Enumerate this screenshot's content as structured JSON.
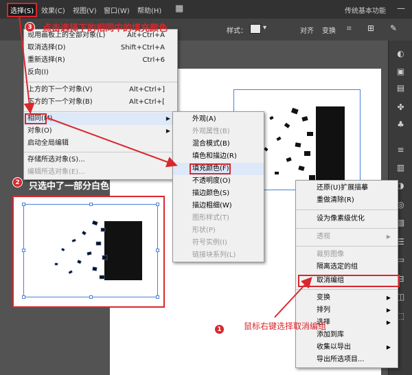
{
  "menubar": {
    "items": [
      "选择(S)",
      "效果(C)",
      "视图(V)",
      "窗口(W)",
      "帮助(H)"
    ],
    "workspace": "传统基本功能"
  },
  "controlbar": {
    "style_label": "样式：",
    "align_label": "对齐",
    "transform_label": "变换"
  },
  "select_menu": {
    "items": [
      {
        "label": "现用画板上的全部对象(L)",
        "shortcut": "Alt+Ctrl+A",
        "disabled": false
      },
      {
        "label": "取消选择(D)",
        "shortcut": "Shift+Ctrl+A",
        "disabled": false
      },
      {
        "label": "重新选择(R)",
        "shortcut": "Ctrl+6",
        "disabled": false
      },
      {
        "label": "反向(I)",
        "shortcut": "",
        "disabled": false
      },
      {
        "label": "上方的下一个对象(V)",
        "shortcut": "Alt+Ctrl+]",
        "disabled": false
      },
      {
        "label": "下方的下一个对象(B)",
        "shortcut": "Alt+Ctrl+[",
        "disabled": false
      },
      {
        "label": "相同(M)",
        "shortcut": "",
        "disabled": false
      },
      {
        "label": "对象(O)",
        "shortcut": "",
        "disabled": false
      },
      {
        "label": "启动全局编辑",
        "shortcut": "",
        "disabled": false
      },
      {
        "label": "存储所选对象(S)...",
        "shortcut": "",
        "disabled": false
      },
      {
        "label": "编辑所选对象(E)...",
        "shortcut": "",
        "disabled": true
      }
    ]
  },
  "same_submenu": {
    "items": [
      {
        "label": "外观(A)",
        "disabled": false
      },
      {
        "label": "外观属性(B)",
        "disabled": true
      },
      {
        "label": "混合模式(B)",
        "disabled": false
      },
      {
        "label": "填色和描边(R)",
        "disabled": false
      },
      {
        "label": "填充颜色(F)",
        "disabled": false
      },
      {
        "label": "不透明度(O)",
        "disabled": false
      },
      {
        "label": "描边颜色(S)",
        "disabled": false
      },
      {
        "label": "描边粗细(W)",
        "disabled": false
      },
      {
        "label": "图形样式(T)",
        "disabled": true
      },
      {
        "label": "形状(P)",
        "disabled": true
      },
      {
        "label": "符号实例(I)",
        "disabled": true
      },
      {
        "label": "链接块系列(L)",
        "disabled": true
      }
    ]
  },
  "context_menu": {
    "items": [
      {
        "label": "还原(U)扩展描摹",
        "disabled": false,
        "arrow": false
      },
      {
        "label": "重做清除(R)",
        "disabled": false,
        "arrow": false
      },
      {
        "label": "设为像素级优化",
        "disabled": false,
        "arrow": false
      },
      {
        "label": "透视",
        "disabled": true,
        "arrow": true
      },
      {
        "label": "裁剪图像",
        "disabled": true,
        "arrow": false
      },
      {
        "label": "隔离选定的组",
        "disabled": false,
        "arrow": false
      },
      {
        "label": "取消编组",
        "disabled": false,
        "arrow": false
      },
      {
        "label": "变换",
        "disabled": false,
        "arrow": true
      },
      {
        "label": "排列",
        "disabled": false,
        "arrow": true
      },
      {
        "label": "选择",
        "disabled": false,
        "arrow": true
      },
      {
        "label": "添加到库",
        "disabled": false,
        "arrow": false
      },
      {
        "label": "收集以导出",
        "disabled": false,
        "arrow": true
      },
      {
        "label": "导出所选项目...",
        "disabled": false,
        "arrow": false
      }
    ]
  },
  "annotations": {
    "step3": {
      "num": "3",
      "text": "点击选择下的相同中的填充颜色"
    },
    "step2": {
      "num": "2",
      "text": "只选中了一部分白色"
    },
    "step1": {
      "num": "1",
      "text": "鼠标右键选择取消编组"
    }
  },
  "colors": {
    "accent_red": "#d8272d",
    "selection_blue": "#4a7fd8"
  }
}
